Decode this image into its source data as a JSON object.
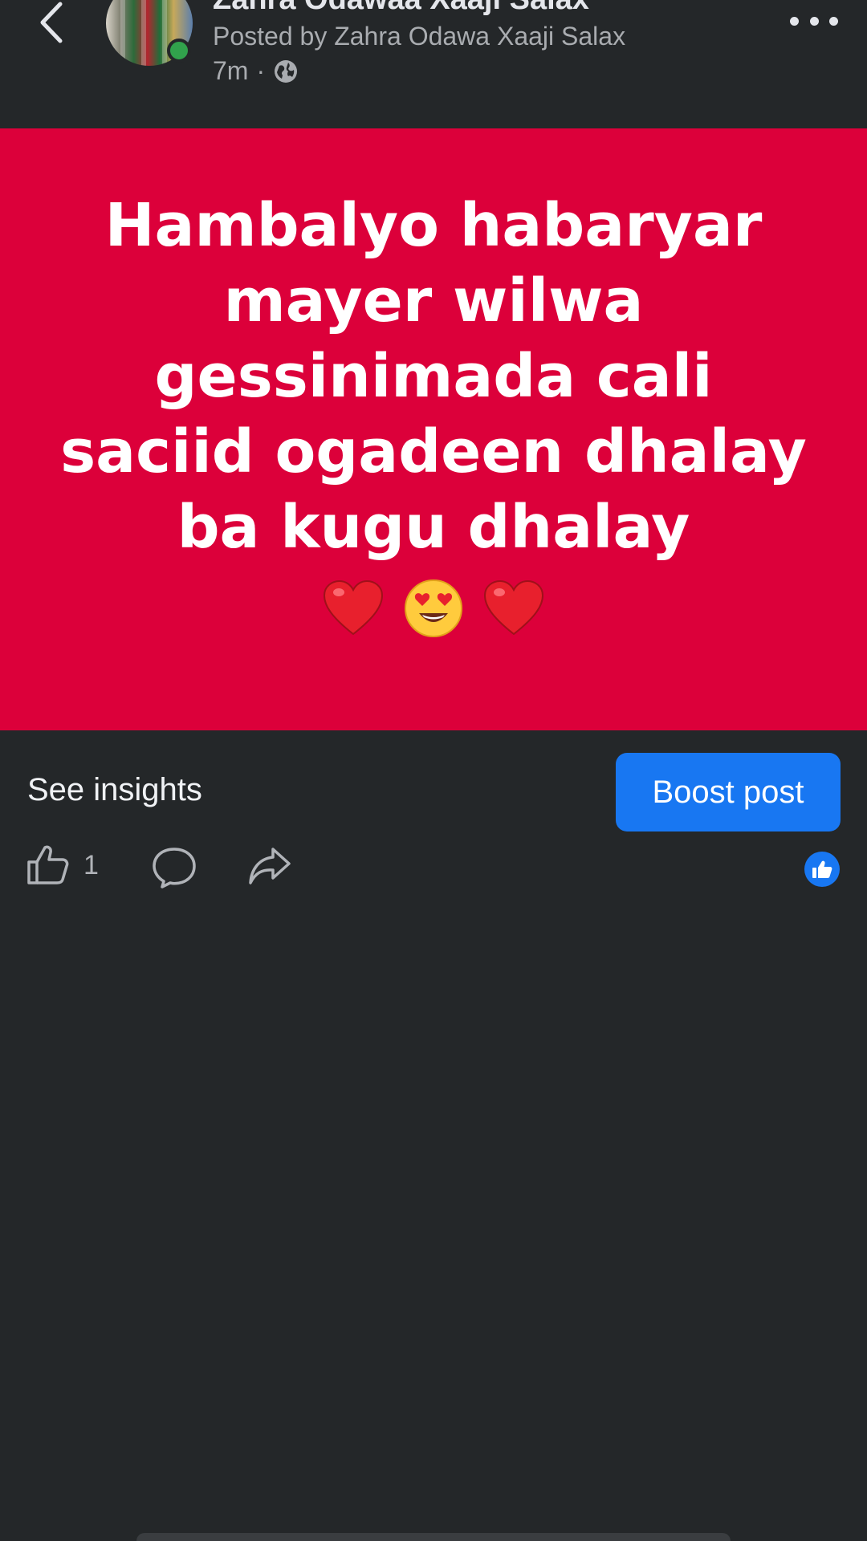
{
  "header": {
    "page_name": "Zahra Odawaa Xaaji Salax",
    "posted_by": "Posted by Zahra Odawa Xaaji Salax",
    "time": "7m",
    "separator": "·",
    "audience_icon": "globe-icon",
    "back_icon": "chevron-left-icon",
    "more_icon": "more-horizontal-icon"
  },
  "post": {
    "background_color": "#dc003a",
    "text": "Hambalyo habaryar mayer wilwa gessinimada cali saciid ogadeen dhalay ba kugu dhalay",
    "emoji": "❤️😍❤️"
  },
  "insights": {
    "see_insights_label": "See insights",
    "boost_label": "Boost post",
    "boost_color": "#1877f2"
  },
  "actions": {
    "like_icon": "thumbs-up-icon",
    "like_count": "1",
    "comment_icon": "comment-icon",
    "share_icon": "share-icon",
    "reaction_icon": "like-reaction-icon"
  }
}
